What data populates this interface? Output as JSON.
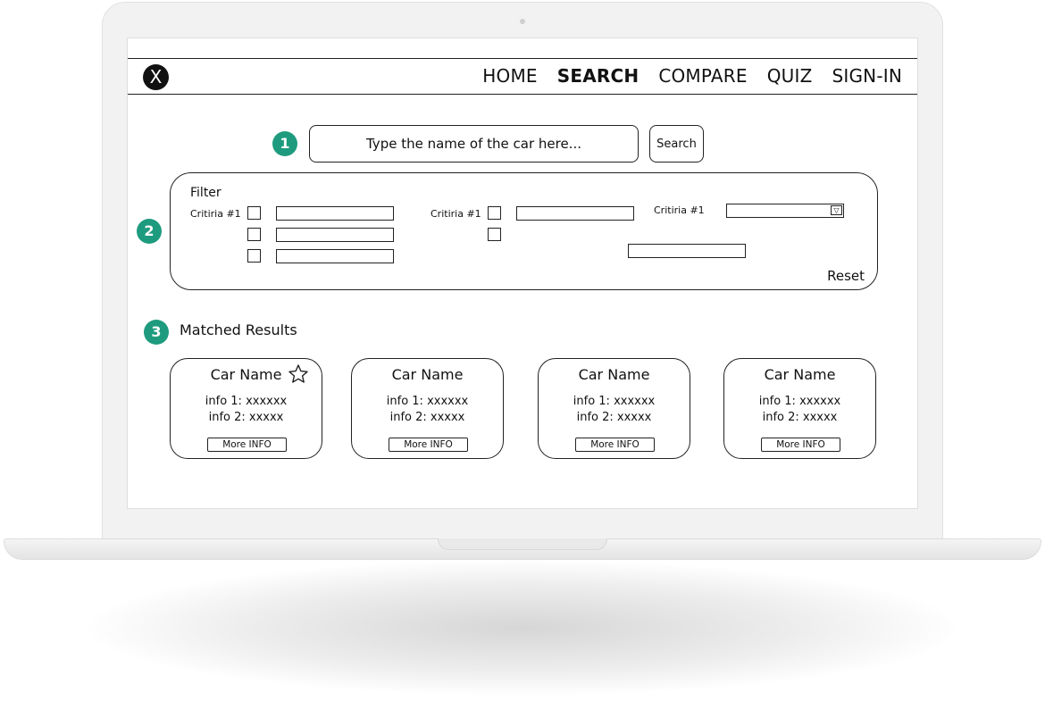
{
  "nav": {
    "logo_letter": "X",
    "links": [
      "HOME",
      "SEARCH",
      "COMPARE",
      "QUIZ",
      "SIGN-IN"
    ],
    "active": "SEARCH"
  },
  "annotations": [
    "1",
    "2",
    "3"
  ],
  "search": {
    "placeholder": "Type the name of the car here...",
    "button_label": "Search"
  },
  "filter": {
    "title": "Filter",
    "criteria_label": "Critiria #1",
    "reset_label": "Reset"
  },
  "results": {
    "title": "Matched Results",
    "cards": [
      {
        "name": "Car Name",
        "info1": "info 1: xxxxxx",
        "info2": "info 2: xxxxx",
        "button": "More INFO",
        "favorite_icon": "star-outline"
      },
      {
        "name": "Car Name",
        "info1": "info 1: xxxxxx",
        "info2": "info 2: xxxxx",
        "button": "More INFO"
      },
      {
        "name": "Car Name",
        "info1": "info 1: xxxxxx",
        "info2": "info 2: xxxxx",
        "button": "More INFO"
      },
      {
        "name": "Car Name",
        "info1": "info 1: xxxxxx",
        "info2": "info 2: xxxxx",
        "button": "More INFO"
      }
    ]
  },
  "colors": {
    "annotation_badge": "#1e9b7e",
    "line": "#222222",
    "laptop_frame": "#f2f2f2"
  }
}
